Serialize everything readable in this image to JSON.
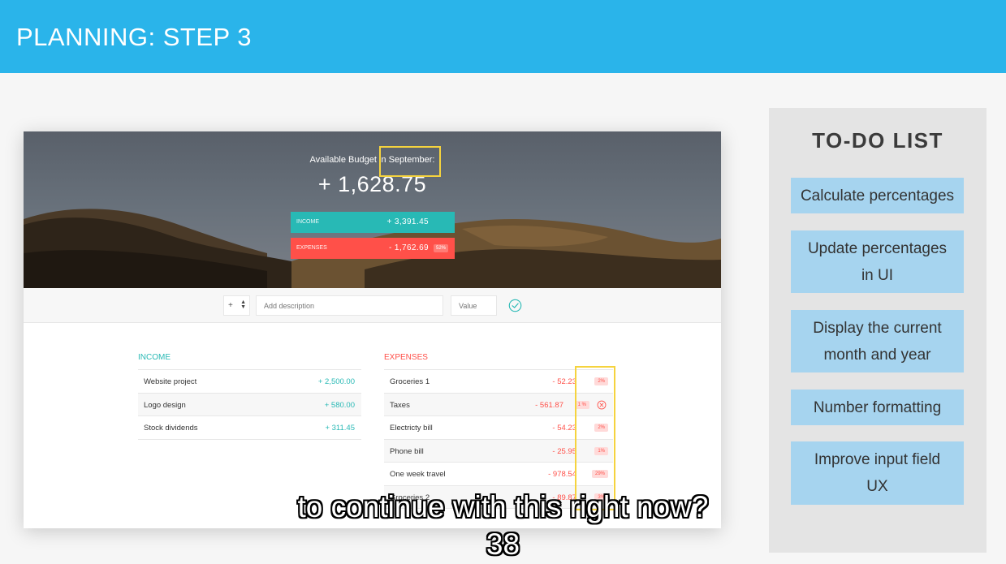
{
  "slide": {
    "title": "PLANNING: STEP 3"
  },
  "budget": {
    "title": "Available Budget in September:",
    "value": "+ 1,628.75",
    "income_label": "Income",
    "income_value": "+ 3,391.45",
    "expenses_label": "Expenses",
    "expenses_value": "- 1,762.69",
    "expenses_percentage": "52%"
  },
  "add_form": {
    "type_value": "+",
    "description_placeholder": "Add description",
    "value_placeholder": "Value"
  },
  "income": {
    "title": "Income",
    "items": [
      {
        "description": "Website project",
        "value": "+ 2,500.00"
      },
      {
        "description": "Logo design",
        "value": "+ 580.00"
      },
      {
        "description": "Stock dividends",
        "value": "+ 311.45"
      }
    ]
  },
  "expenses": {
    "title": "Expenses",
    "items": [
      {
        "description": "Groceries 1",
        "value": "- 52.23",
        "percentage": "2%"
      },
      {
        "description": "Taxes",
        "value": "- 561.87",
        "percentage": "1 %"
      },
      {
        "description": "Electricty bill",
        "value": "- 54.23",
        "percentage": "2%"
      },
      {
        "description": "Phone bill",
        "value": "- 25.95",
        "percentage": "1%"
      },
      {
        "description": "One week travel",
        "value": "- 978.54",
        "percentage": "29%"
      },
      {
        "description": "Groceries 2",
        "value": "- 89.87",
        "percentage": "3%"
      }
    ]
  },
  "todo": {
    "title": "TO-DO LIST",
    "items": [
      "Calculate percentages",
      "Update percentages in UI",
      "Display the current month and year",
      "Number formatting",
      "Improve input field UX"
    ]
  },
  "caption": {
    "line1": "to continue with this right now?",
    "line2": "38"
  },
  "colors": {
    "header": "#2ab4ea",
    "income": "#28b9b5",
    "expenses": "#ff5049",
    "highlight": "#f5d33e",
    "todo_item": "#a6d4ef"
  },
  "icons": {
    "add": "checkmark-circle-icon",
    "delete": "close-circle-icon",
    "select_arrows": "up-down-arrows-icon"
  }
}
